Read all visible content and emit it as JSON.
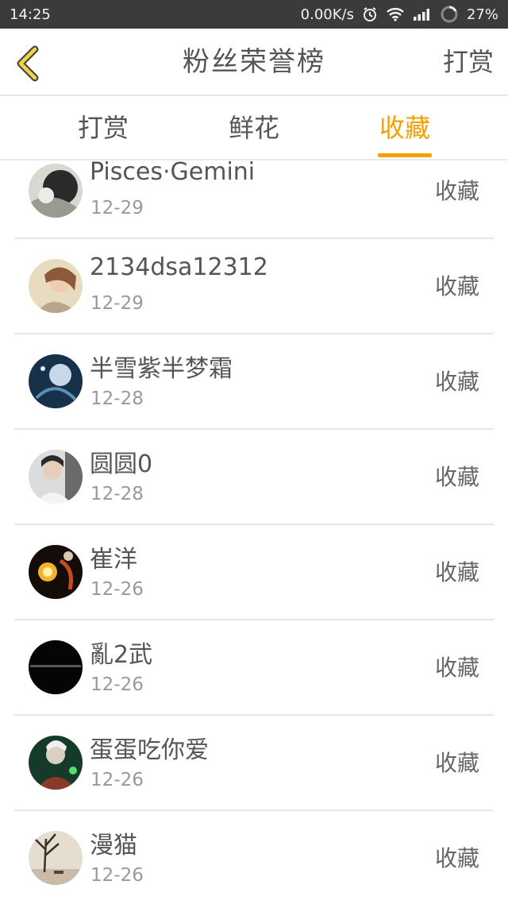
{
  "status_bar": {
    "time": "14:25",
    "net_speed": "0.00K/s",
    "battery": "27%",
    "icons": [
      "alarm-icon",
      "wifi-icon",
      "signal-icon",
      "battery-icon"
    ]
  },
  "header": {
    "title": "粉丝荣誉榜",
    "action_label": "打赏",
    "back_icon": "chevron-left-icon",
    "accent_color": "#f5a000"
  },
  "tabs": [
    {
      "label": "打赏",
      "active": false
    },
    {
      "label": "鲜花",
      "active": false
    },
    {
      "label": "收藏",
      "active": true
    }
  ],
  "list": {
    "items": [
      {
        "name": "Pisces·Gemini",
        "date": "12-29",
        "action": "收藏"
      },
      {
        "name": "2134dsa12312",
        "date": "12-29",
        "action": "收藏"
      },
      {
        "name": "半雪紫半梦霜",
        "date": "12-28",
        "action": "收藏"
      },
      {
        "name": "圆圆0",
        "date": "12-28",
        "action": "收藏"
      },
      {
        "name": "崔洋",
        "date": "12-26",
        "action": "收藏"
      },
      {
        "name": "亂2武",
        "date": "12-26",
        "action": "收藏"
      },
      {
        "name": "蛋蛋吃你爱",
        "date": "12-26",
        "action": "收藏"
      },
      {
        "name": "漫猫",
        "date": "12-26",
        "action": "收藏"
      }
    ]
  }
}
